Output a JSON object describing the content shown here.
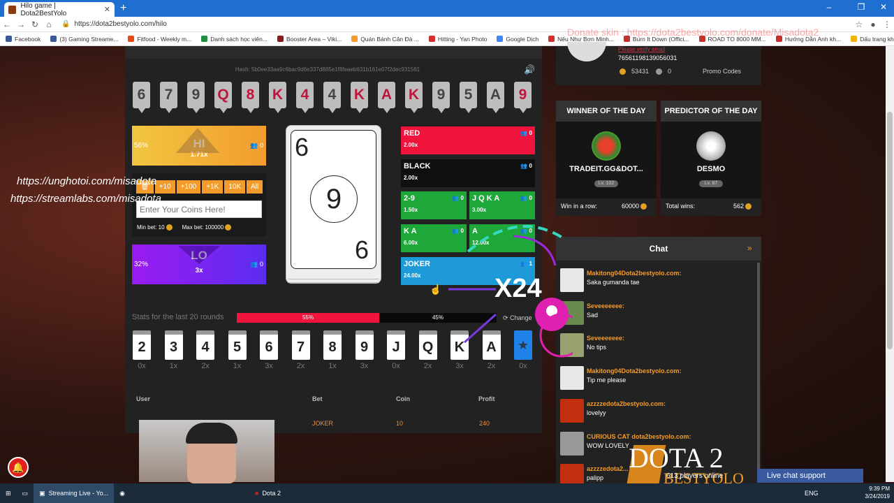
{
  "browser": {
    "tab_title": "Hilo game | Dota2BestYolo",
    "url": "https://dota2bestyolo.com/hilo",
    "bookmarks": [
      "Facebook",
      "(3) Gaming Streame...",
      "Fitfood - Weekly m...",
      "Danh sách học viên...",
      "Booster Area – Viki...",
      "Quán Bánh Căn Đà ...",
      "Hitting - Yan Photo",
      "Google Dịch",
      "Nếu Như Bơn Minh...",
      "Burn It Down (Offici...",
      "ROAD TO 8000 MM...",
      "Hướng Dẫn Anh kh...",
      "Dấu trang khác"
    ],
    "donate_overlay": "Donate skin : https://dota2bestyolo.com/donate/Misadota2"
  },
  "game": {
    "hash": "Hash: 5b0ee33aa9c6bac9d6e337d885e1f8feaeb631b161e07f2dec931561",
    "history": [
      {
        "v": "6",
        "red": false
      },
      {
        "v": "7",
        "red": false
      },
      {
        "v": "9",
        "red": false
      },
      {
        "v": "Q",
        "red": true
      },
      {
        "v": "8",
        "red": true
      },
      {
        "v": "K",
        "red": true
      },
      {
        "v": "4",
        "red": true
      },
      {
        "v": "4",
        "red": false
      },
      {
        "v": "K",
        "red": true
      },
      {
        "v": "A",
        "red": true
      },
      {
        "v": "K",
        "red": true
      },
      {
        "v": "9",
        "red": false
      },
      {
        "v": "5",
        "red": false
      },
      {
        "v": "A",
        "red": false
      },
      {
        "v": "9",
        "red": true
      }
    ],
    "hi": {
      "pct": "56%",
      "label": "HI",
      "mult": "1.71x",
      "users": "0"
    },
    "lo": {
      "pct": "32%",
      "label": "LO",
      "mult": "3x",
      "users": "0"
    },
    "bet_buttons": [
      "+10",
      "+100",
      "+1K",
      "10K",
      "All"
    ],
    "coin_placeholder": "Enter Your Coins Here!",
    "min_bet": "Min bet: 10",
    "max_bet": "Max bet: 100000",
    "current_card": {
      "corner": "6",
      "center": "9"
    },
    "bets": [
      {
        "name": "RED",
        "mult": "2.00x",
        "users": "0",
        "color": "#f0143c"
      },
      {
        "name": "BLACK",
        "mult": "2.00x",
        "users": "0",
        "color": "#0f0f0f"
      },
      {
        "name": "2-9",
        "mult": "1.50x",
        "users": "0",
        "color": "#1fa83a"
      },
      {
        "name": "J Q K A",
        "mult": "3.00x",
        "users": "0",
        "color": "#1fa83a"
      },
      {
        "name": "K A",
        "mult": "6.00x",
        "users": "0",
        "color": "#1fa83a"
      },
      {
        "name": "A",
        "mult": "12.00x",
        "users": "0",
        "color": "#1fa83a"
      },
      {
        "name": "JOKER",
        "mult": "24.00x",
        "users": "1",
        "color": "#1e9ad8"
      }
    ],
    "stats_label": "Stats for the last 20 rounds",
    "red_pct": "55%",
    "black_pct": "45%",
    "change_label": "Change",
    "stats_cards": [
      {
        "v": "2",
        "c": "0x"
      },
      {
        "v": "3",
        "c": "1x"
      },
      {
        "v": "4",
        "c": "2x"
      },
      {
        "v": "5",
        "c": "1x"
      },
      {
        "v": "6",
        "c": "3x"
      },
      {
        "v": "7",
        "c": "2x"
      },
      {
        "v": "8",
        "c": "1x"
      },
      {
        "v": "9",
        "c": "3x"
      },
      {
        "v": "J",
        "c": "0x"
      },
      {
        "v": "Q",
        "c": "2x"
      },
      {
        "v": "K",
        "c": "3x"
      },
      {
        "v": "A",
        "c": "2x"
      }
    ],
    "joker_count": "0x",
    "table_headers": [
      "User",
      "Bet",
      "Coin",
      "Profit"
    ],
    "table_row": {
      "bet": "JOKER",
      "coin": "10",
      "profit": "240"
    }
  },
  "profile": {
    "name": "Please verify email",
    "steam_id": "76561198139056031",
    "coins": "53431",
    "gems": "0",
    "promo": "Promo Codes"
  },
  "winner": {
    "title": "WINNER OF THE DAY",
    "name": "TRADEIT.GG&DOT...",
    "level": "Lv. 102",
    "stat_label": "Win in a row:",
    "stat_value": "60000"
  },
  "predictor": {
    "title": "PREDICTOR OF THE DAY",
    "name": "DESMO",
    "level": "Lv. 87",
    "stat_label": "Total wins:",
    "stat_value": "562"
  },
  "chat": {
    "title": "Chat",
    "messages": [
      {
        "user": "Makitong04Dota2bestyolo.com:",
        "text": "Saka gumanda tae"
      },
      {
        "user": "Seveeeeeee:",
        "text": "Sad"
      },
      {
        "user": "Seveeeeeee:",
        "text": "No tips"
      },
      {
        "user": "Makitong04Dota2bestyolo.com:",
        "text": "Tip me please"
      },
      {
        "user": "azzzzedota2bestyolo.com:",
        "text": "lovelyy"
      },
      {
        "user": "CURIOUS CAT dota2bestyolo.com:",
        "text": "WOW LOVELY"
      },
      {
        "user": "azzzzedota2...",
        "text": "palipp"
      }
    ]
  },
  "overlay": {
    "link1": "https://unghotoi.com/misadota",
    "link2": "https://streamlabs.com/misadota",
    "x24": "X24",
    "dota": "DOTA 2",
    "dota_sub": "BESTYOLO",
    "online": "613 players online",
    "live_chat": "Live chat support"
  },
  "taskbar": {
    "items": [
      "Streaming Live - Yo...",
      "Dota 2"
    ],
    "lang": "ENG",
    "time": "9:39 PM",
    "date": "3/24/2019"
  }
}
